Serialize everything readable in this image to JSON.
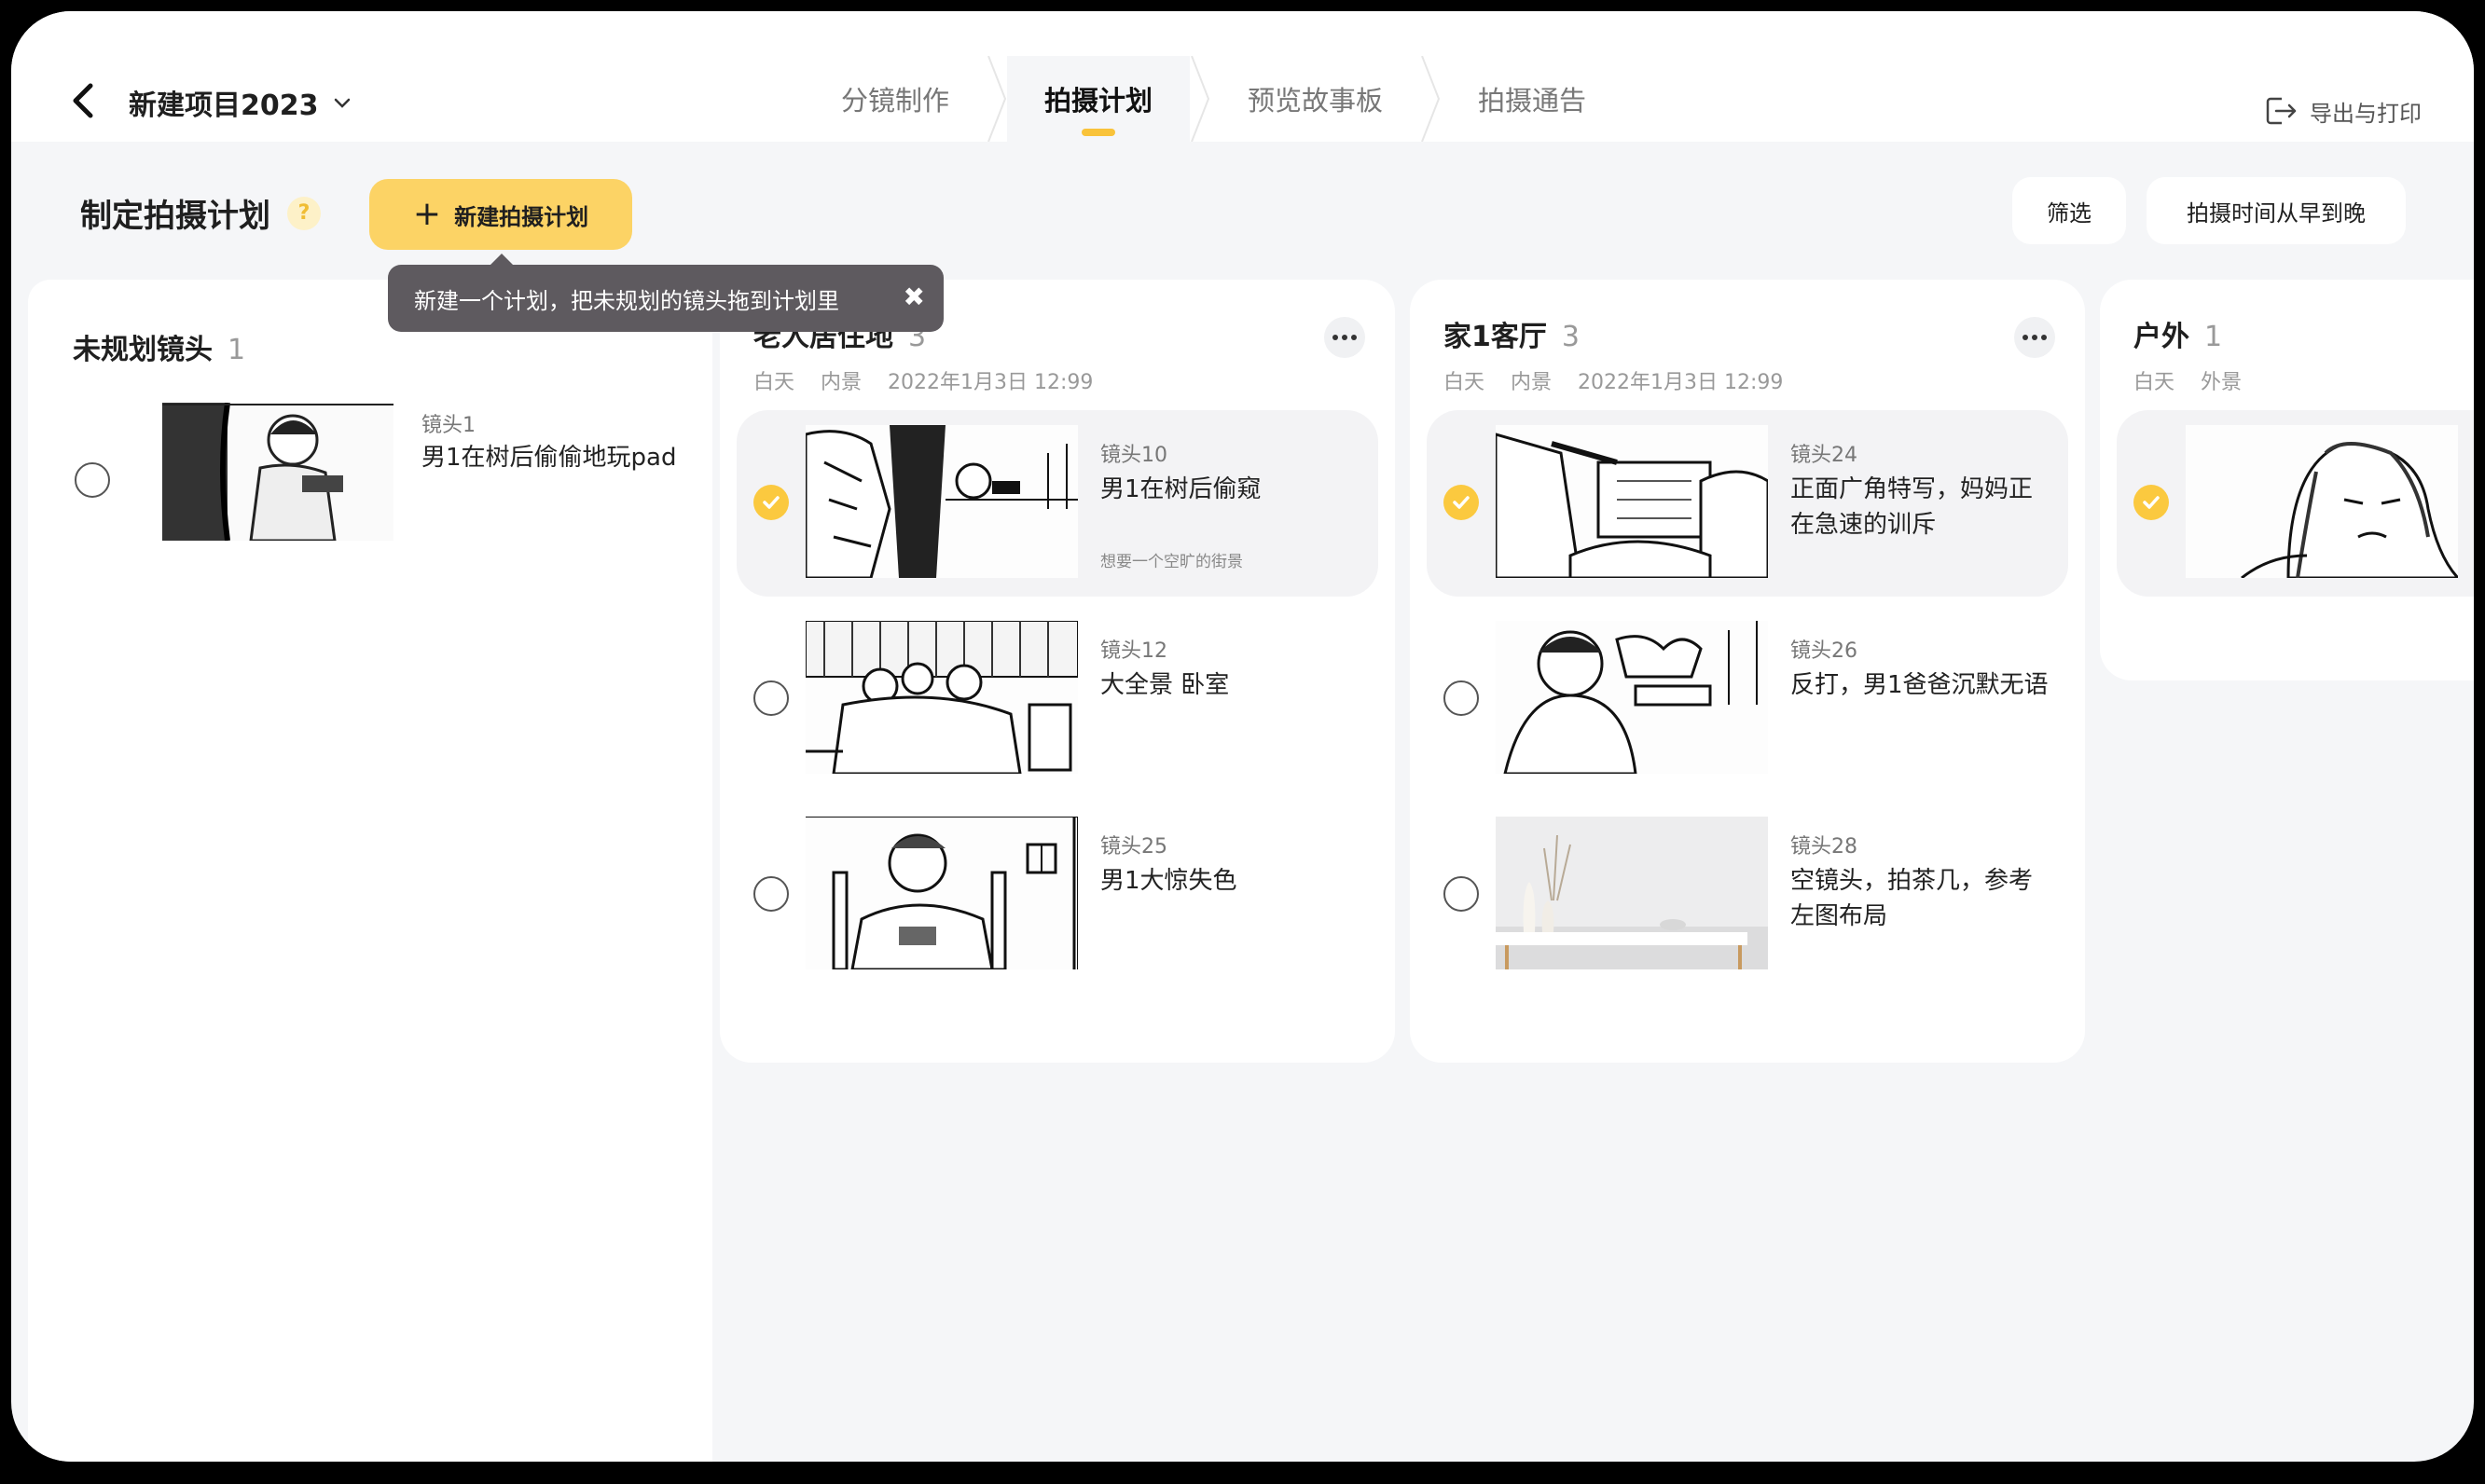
{
  "topbar": {
    "project_name": "新建项目2023",
    "tabs": [
      {
        "label": "分镜制作"
      },
      {
        "label": "拍摄计划"
      },
      {
        "label": "预览故事板"
      },
      {
        "label": "拍摄通告"
      }
    ],
    "active_tab": "拍摄计划",
    "export_label": "导出与打印"
  },
  "subheader": {
    "title": "制定拍摄计划",
    "help_glyph": "?",
    "new_plan_label": "新建拍摄计划",
    "filter_label": "筛选",
    "sort_label": "拍摄时间从早到晚"
  },
  "tooltip": {
    "text": "新建一个计划，把未规划的镜头拖到计划里"
  },
  "unplanned": {
    "title": "未规划镜头",
    "count": "1",
    "shots": [
      {
        "label": "镜头1",
        "title": "男1在树后偷偷地玩pad",
        "checked": false
      }
    ]
  },
  "plans": [
    {
      "title": "老人居住地",
      "count": "3",
      "meta": {
        "time": "白天",
        "scene": "内景",
        "date": "2022年1月3日 12:99"
      },
      "shots": [
        {
          "label": "镜头10",
          "title": "男1在树后偷窥",
          "note": "想要一个空旷的街景",
          "checked": true
        },
        {
          "label": "镜头12",
          "title": "大全景 卧室",
          "note": "",
          "checked": false
        },
        {
          "label": "镜头25",
          "title": "男1大惊失色",
          "note": "",
          "checked": false
        }
      ]
    },
    {
      "title": "家1客厅",
      "count": "3",
      "meta": {
        "time": "白天",
        "scene": "内景",
        "date": "2022年1月3日 12:99"
      },
      "shots": [
        {
          "label": "镜头24",
          "title": "正面广角特写，妈妈正在急速的训斥",
          "note": "",
          "checked": true
        },
        {
          "label": "镜头26",
          "title": "反打，男1爸爸沉默无语",
          "note": "",
          "checked": false
        },
        {
          "label": "镜头28",
          "title": "空镜头，拍茶几，参考左图布局",
          "note": "",
          "checked": false
        }
      ]
    },
    {
      "title": "户外",
      "count": "1",
      "meta": {
        "time": "白天",
        "scene": "外景"
      },
      "shots": [
        {
          "label": "",
          "title": "",
          "note": "",
          "checked": true
        }
      ]
    }
  ],
  "colors": {
    "accent": "#fcd365",
    "check": "#fbc93f",
    "tooltip_bg": "#5e5a5f",
    "page_bg": "#f5f6f8"
  }
}
